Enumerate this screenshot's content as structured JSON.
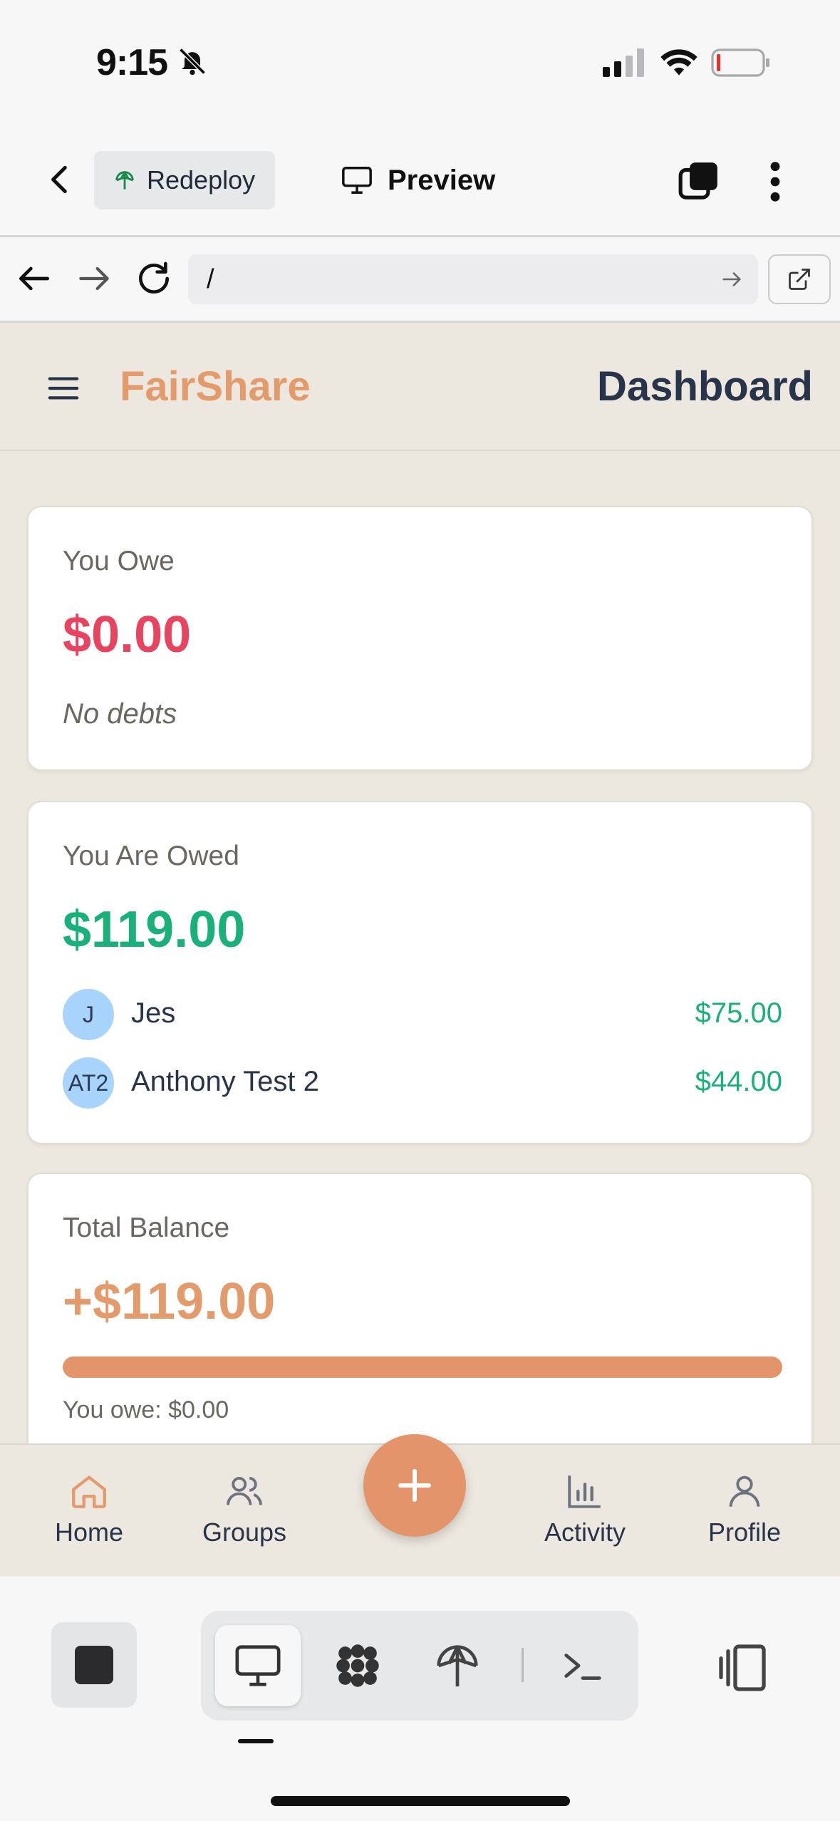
{
  "status_bar": {
    "time": "9:15"
  },
  "toolbar": {
    "redeploy_label": "Redeploy",
    "preview_label": "Preview"
  },
  "browser": {
    "url": "/"
  },
  "app": {
    "brand": "FairShare",
    "page_title": "Dashboard",
    "cards": {
      "you_owe": {
        "label": "You Owe",
        "amount": "$0.00",
        "note": "No debts"
      },
      "you_are_owed": {
        "label": "You Are Owed",
        "amount": "$119.00",
        "people": [
          {
            "initials": "J",
            "name": "Jes",
            "amount": "$75.00"
          },
          {
            "initials": "AT2",
            "name": "Anthony Test 2",
            "amount": "$44.00"
          }
        ]
      },
      "total_balance": {
        "label": "Total Balance",
        "amount": "+$119.00",
        "progress_fraction": 1.0,
        "you_owe_note": "You owe: $0.00"
      }
    },
    "bottom_nav": {
      "home": "Home",
      "groups": "Groups",
      "activity": "Activity",
      "profile": "Profile"
    }
  },
  "colors": {
    "brand": "#e49b6b",
    "owe_red": "#e8445f",
    "owed_green": "#19b07a",
    "background": "#ede8df"
  }
}
